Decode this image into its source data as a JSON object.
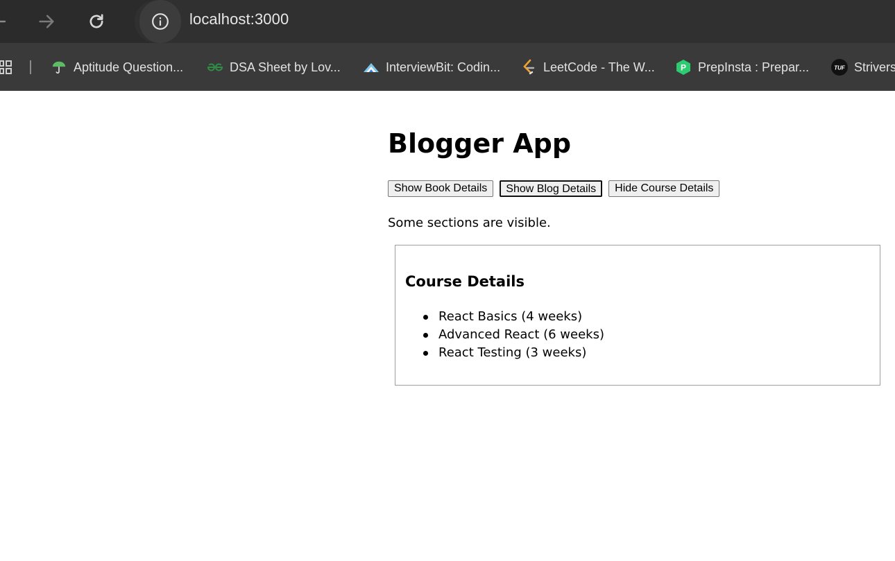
{
  "browser": {
    "url": "localhost:3000",
    "bookmarks": [
      {
        "label": "Aptitude Question...",
        "icon": "umbrella-icon"
      },
      {
        "label": "DSA Sheet by Lov...",
        "icon": "gfg-icon"
      },
      {
        "label": "InterviewBit: Codin...",
        "icon": "interviewbit-icon"
      },
      {
        "label": "LeetCode - The W...",
        "icon": "leetcode-icon"
      },
      {
        "label": "PrepInsta : Prepar...",
        "icon": "prepinsta-icon"
      },
      {
        "label": "Strivers",
        "icon": "tuf-icon"
      }
    ],
    "tuf_logo_text": "TUF",
    "prepinsta_logo_text": "P"
  },
  "app": {
    "title": "Blogger App",
    "buttons": {
      "book": "Show Book Details",
      "blog": "Show Blog Details",
      "course": "Hide Course Details"
    },
    "status": "Some sections are visible.",
    "course": {
      "heading": "Course Details",
      "items": [
        "React Basics (4 weeks)",
        "Advanced React (6 weeks)",
        "React Testing (3 weeks)"
      ]
    }
  },
  "colors": {
    "toolbar": "#2b2b2b",
    "bookmarks_bar": "#3a3a3a",
    "page_bg": "#ffffff"
  }
}
